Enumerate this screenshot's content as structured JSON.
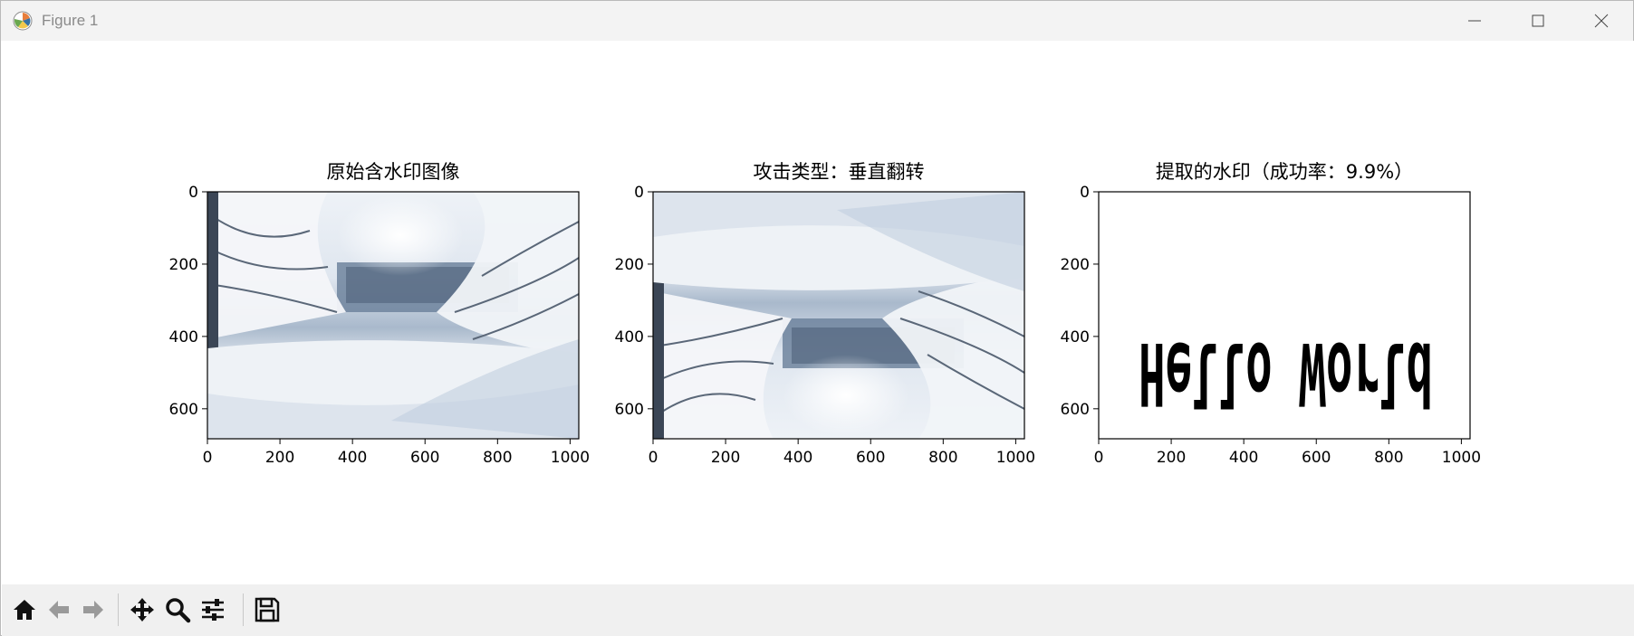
{
  "window": {
    "title": "Figure 1"
  },
  "chart_data": [
    {
      "type": "image",
      "title": "原始含水印图像",
      "image_description": "snow-covered pine branches framing a snowy clearing",
      "xticks": [
        "0",
        "200",
        "400",
        "600",
        "800",
        "1000"
      ],
      "yticks": [
        "0",
        "200",
        "400",
        "600"
      ],
      "xlim": [
        0,
        1024
      ],
      "ylim": [
        683,
        0
      ]
    },
    {
      "type": "image",
      "title": "攻击类型：垂直翻转",
      "image_description": "the same snowy scene flipped vertically",
      "xticks": [
        "0",
        "200",
        "400",
        "600",
        "800",
        "1000"
      ],
      "yticks": [
        "0",
        "200",
        "400",
        "600"
      ],
      "xlim": [
        0,
        1024
      ],
      "ylim": [
        683,
        0
      ]
    },
    {
      "type": "image",
      "title": "提取的水印（成功率：9.9%）",
      "extracted_text": "Hello World",
      "text_flipped_vertically": true,
      "xticks": [
        "0",
        "200",
        "400",
        "600",
        "800",
        "1000"
      ],
      "yticks": [
        "0",
        "200",
        "400",
        "600"
      ],
      "xlim": [
        0,
        1024
      ],
      "ylim": [
        683,
        0
      ]
    }
  ],
  "toolbar": {
    "buttons": [
      "home-icon",
      "back-arrow-icon",
      "forward-arrow-icon",
      "pan-icon",
      "zoom-icon",
      "configure-subplots-icon",
      "save-icon"
    ]
  },
  "colors": {
    "titlebar": "#f3f3f3",
    "toolbar": "#f0f0f0",
    "axes_frame": "#000000",
    "snow_light": "#f2f5f9",
    "snow_blue": "#8ea3bd",
    "tree_dark": "#3b4656"
  }
}
